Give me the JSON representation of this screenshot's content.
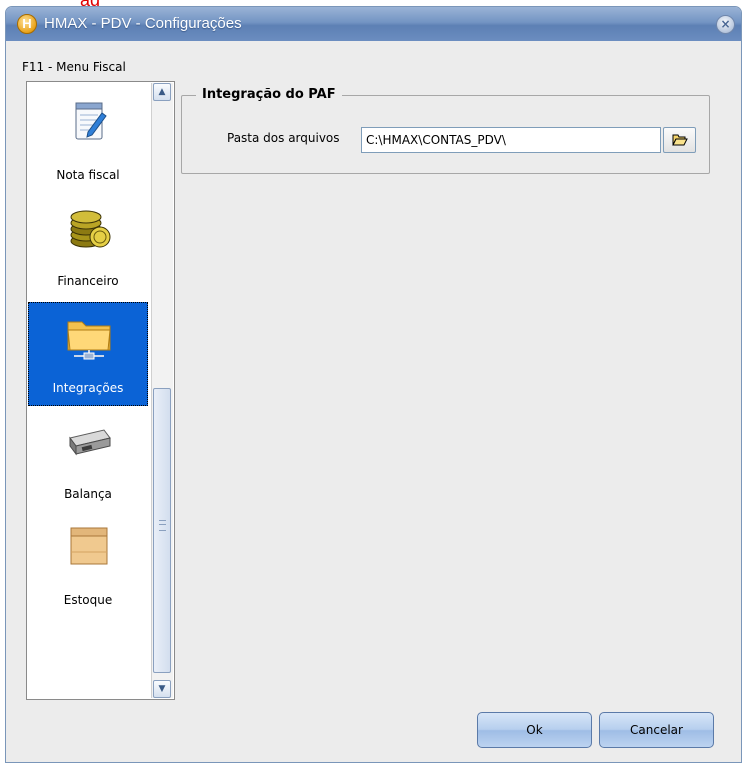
{
  "window": {
    "title": "HMAX - PDV - Configurações",
    "app_icon_letter": "H",
    "close_glyph": "×",
    "top_clipped_text": "ag"
  },
  "sidebar": {
    "panel_label": "F11 - Menu Fiscal",
    "items": [
      {
        "label": "Nota fiscal",
        "icon": "notepad-icon",
        "selected": false
      },
      {
        "label": "Financeiro",
        "icon": "coins-icon",
        "selected": false
      },
      {
        "label": "Integrações",
        "icon": "folder-network-icon",
        "selected": true
      },
      {
        "label": "Balança",
        "icon": "scale-icon",
        "selected": false
      },
      {
        "label": "Estoque",
        "icon": "box-icon",
        "selected": false
      }
    ],
    "scroll_up_glyph": "▲",
    "scroll_down_glyph": "▼"
  },
  "integration": {
    "group_title": "Integração do PAF",
    "folder_label": "Pasta dos arquivos",
    "folder_value": "C:\\HMAX\\CONTAS_PDV\\"
  },
  "buttons": {
    "ok_label": "Ok",
    "cancel_label": "Cancelar"
  },
  "colors": {
    "selection": "#0b63d6",
    "titlebar": "#6b8dc0"
  }
}
